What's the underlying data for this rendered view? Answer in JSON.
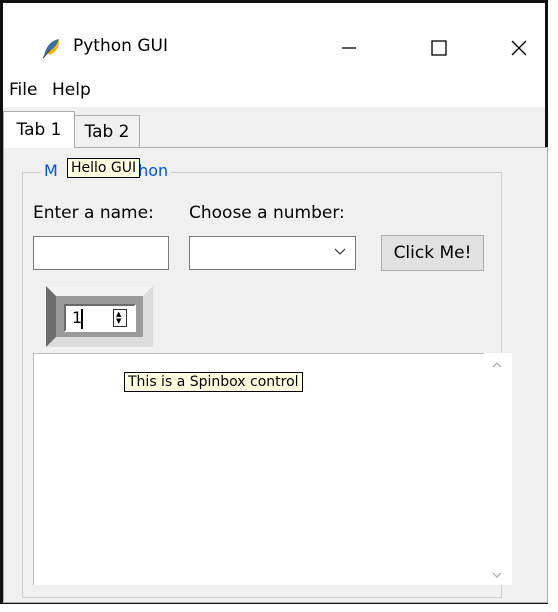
{
  "window": {
    "title": "Python GUI",
    "controls": {
      "minimize": "minimize",
      "maximize": "maximize",
      "close": "close"
    }
  },
  "menu": {
    "items": [
      "File",
      "Help"
    ]
  },
  "tabs": [
    {
      "label": "Tab 1",
      "active": true
    },
    {
      "label": "Tab 2",
      "active": false
    }
  ],
  "frame": {
    "title_visible_fragment": "thon",
    "title_first_char": "M"
  },
  "form": {
    "name_label": "Enter a name:",
    "number_label": "Choose a number:",
    "name_value": "",
    "combo_value": "",
    "button_label": "Click Me!"
  },
  "spinbox": {
    "value": "1"
  },
  "tooltips": {
    "hello": "Hello GUI",
    "spinbox": "This is a Spinbox control"
  },
  "icons": {
    "app": "python-feather-icon",
    "combo": "chevron-down-icon",
    "scroll_up": "chevron-up-icon",
    "scroll_down": "chevron-down-icon"
  },
  "colors": {
    "frame_title": "#0055d4",
    "tooltip_bg": "#ffffe1",
    "button_bg": "#e1e1e1"
  }
}
